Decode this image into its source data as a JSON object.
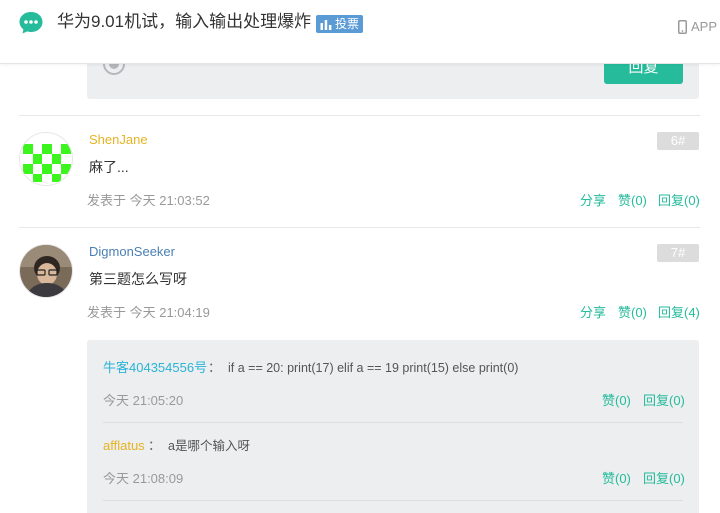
{
  "header": {
    "title": "华为9.01机试，输入输出处理爆炸",
    "vote_badge": "投票",
    "app_label": "APP"
  },
  "previous_reply": {
    "reply_button": "回复"
  },
  "posts": [
    {
      "username": "ShenJane",
      "username_color": "#e6b422",
      "floor": "6#",
      "content": "麻了...",
      "posted_at": "发表于 今天 21:03:52",
      "share_label": "分享",
      "like_label": "赞(0)",
      "reply_label": "回复(0)",
      "avatar_icon": "green-checker-avatar"
    },
    {
      "username": "DigmonSeeker",
      "username_color": "#4a7fb5",
      "floor": "7#",
      "content": "第三题怎么写呀",
      "posted_at": "发表于 今天 21:04:19",
      "share_label": "分享",
      "like_label": "赞(0)",
      "reply_label": "回复(4)",
      "avatar_icon": "photo-avatar"
    }
  ],
  "sub_comments": [
    {
      "username": "牛客404354556号",
      "username_color": "#2db3d6",
      "separator": "：",
      "text": "if a == 20: print(17) elif a == 19 print(15) else print(0)",
      "time": "今天 21:05:20",
      "like_label": "赞(0)",
      "reply_label": "回复(0)"
    },
    {
      "username": "afflatus",
      "username_color": "#e6b422",
      "separator": "：",
      "text": "a是哪个输入呀",
      "time": "今天 21:08:09",
      "like_label": "赞(0)",
      "reply_label": "回复(0)"
    }
  ],
  "colors": {
    "accent": "#25bb9b",
    "sub_box_bg": "#eceef0",
    "floor_badge": "#dcdcdc",
    "vote_badge": "#5b9bd5"
  }
}
